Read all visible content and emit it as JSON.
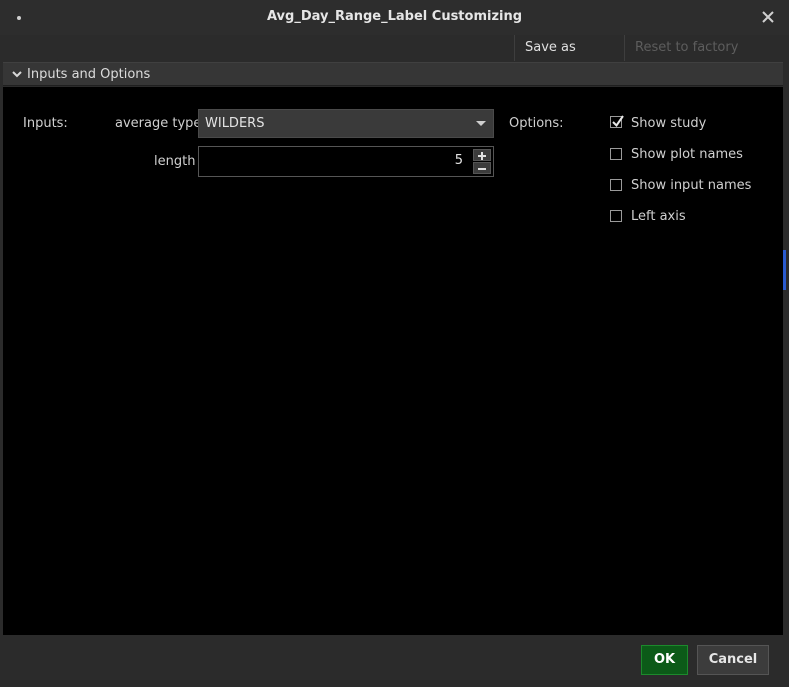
{
  "window": {
    "title": "Avg_Day_Range_Label Customizing"
  },
  "toolbar": {
    "save_default": "Save as default",
    "reset_factory": "Reset to factory default"
  },
  "section": {
    "title": "Inputs and Options"
  },
  "inputs": {
    "label": "Inputs:",
    "average_type_label": "average type",
    "average_type_value": "WILDERS",
    "length_label": "length",
    "length_value": "5"
  },
  "options": {
    "label": "Options:",
    "items": [
      {
        "label": "Show study",
        "checked": true
      },
      {
        "label": "Show plot names",
        "checked": false
      },
      {
        "label": "Show input names",
        "checked": false
      },
      {
        "label": "Left axis",
        "checked": false
      }
    ]
  },
  "footer": {
    "ok_label": "OK",
    "cancel_label": "Cancel"
  },
  "colors": {
    "ok_button": "#0c5a18",
    "content_bg": "#000000",
    "chrome_bg": "#2b2b2b"
  }
}
